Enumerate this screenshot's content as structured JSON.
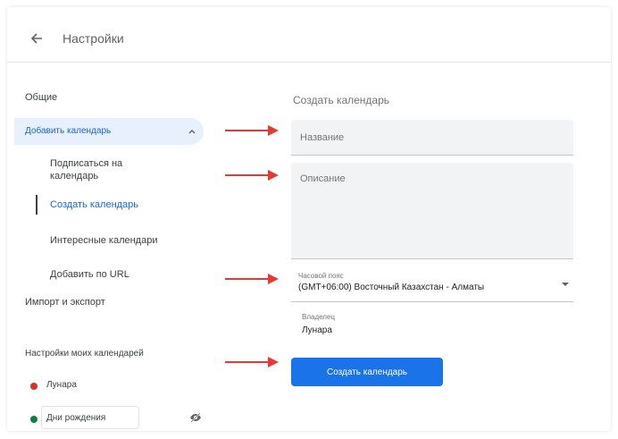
{
  "header": {
    "title": "Настройки"
  },
  "sidebar": {
    "general": "Общие",
    "add_calendar": "Добавить календарь",
    "sub_items": [
      {
        "label": "Подписаться на календарь"
      },
      {
        "label": "Создать календарь"
      },
      {
        "label": "Интересные календари"
      },
      {
        "label": "Добавить по URL"
      }
    ],
    "import_export": "Импорт и экспорт",
    "my_calendars_title": "Настройки моих календарей",
    "calendars": [
      {
        "name": "Лунара",
        "color": "#d93025"
      },
      {
        "name": "Дни рождения",
        "color": "#0b8043"
      }
    ]
  },
  "form": {
    "section_title": "Создать календарь",
    "name_placeholder": "Название",
    "description_placeholder": "Описание",
    "timezone_label": "Часовой пояс",
    "timezone_value": "(GMT+06:00) Восточный Казахстан - Алматы",
    "owner_label": "Владелец",
    "owner_value": "Лунара",
    "create_button": "Создать календарь"
  },
  "colors": {
    "accent": "#1a73e8",
    "arrow": "#e53935"
  }
}
